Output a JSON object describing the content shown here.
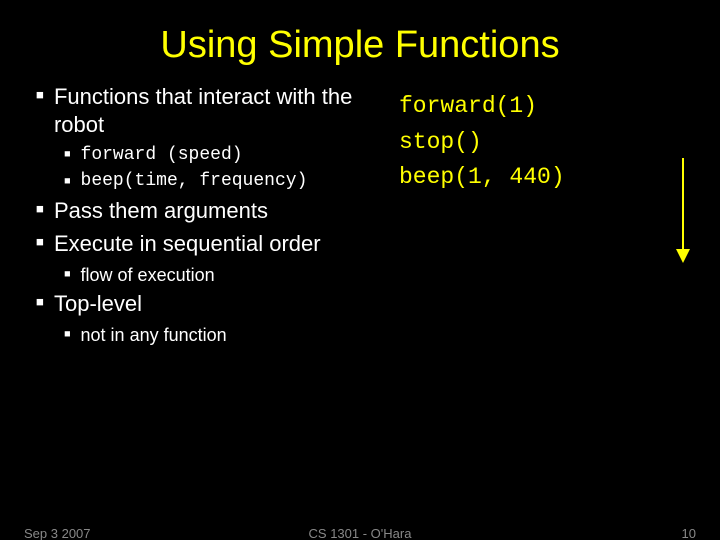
{
  "title": "Using Simple Functions",
  "left": {
    "b1": "Functions that interact with the robot",
    "b1s1": "forward (speed)",
    "b1s2": "beep(time, frequency)",
    "b2": "Pass them arguments",
    "b3": "Execute in sequential order",
    "b3s1": "flow of execution",
    "b4": "Top-level",
    "b4s1": "not in any function"
  },
  "code": {
    "l1": "forward(1)",
    "l2": "stop()",
    "l3": "beep(1, 440)"
  },
  "footer": {
    "date": "Sep 3 2007",
    "center": "CS 1301 - O'Hara",
    "num": "10"
  }
}
